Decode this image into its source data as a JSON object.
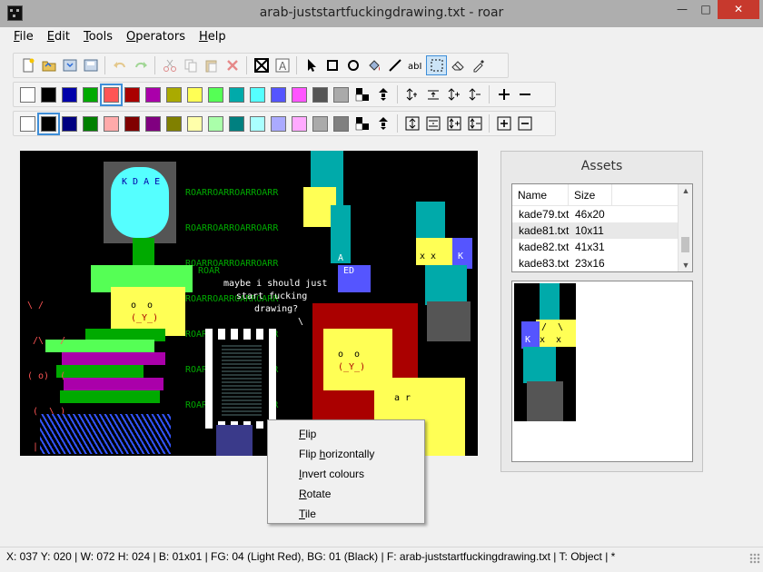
{
  "window": {
    "title": "arab-juststartfuckingdrawing.txt - roar"
  },
  "menu": [
    {
      "label": "File",
      "key": "F",
      "rest": "ile"
    },
    {
      "label": "Edit",
      "key": "E",
      "rest": "dit"
    },
    {
      "label": "Tools",
      "key": "T",
      "rest": "ools"
    },
    {
      "label": "Operators",
      "key": "O",
      "rest": "perators"
    },
    {
      "label": "Help",
      "key": "H",
      "rest": "elp"
    }
  ],
  "palette": {
    "fg": [
      "#ffffff",
      "#000000",
      "#0000aa",
      "#00aa00",
      "#ff5555",
      "#aa0000",
      "#aa00aa",
      "#aaaa00",
      "#ffff55",
      "#55ff55",
      "#00aaaa",
      "#55ffff",
      "#5555ff",
      "#ff55ff",
      "#555555",
      "#aaaaaa"
    ],
    "bg": [
      "#ffffff",
      "#000000",
      "#000080",
      "#008000",
      "#ffaaaa",
      "#800000",
      "#800080",
      "#808000",
      "#ffffaa",
      "#aaffaa",
      "#008080",
      "#aaffff",
      "#aaaaff",
      "#ffaaff",
      "#aaaaaa",
      "#808080"
    ],
    "fg_selected_index": 4,
    "bg_selected_index": 1
  },
  "canvas_text": {
    "roar_lines": [
      "ROARROARROARROARR",
      "ROARROARROARROARR",
      "ROARROARROARROARR",
      "ROARROARROARROARR",
      "ROARROARROARROARR",
      "ROARROARROARROARR",
      "ROARROARROARROARR"
    ],
    "roar_small": "ROAR",
    "speech": [
      "maybe i should just",
      "start fucking",
      "drawing?",
      "\\"
    ],
    "balloon_letters": "K D A E",
    "face1": "o  o",
    "mouth1": "(_Y_)",
    "face2": "o  o",
    "mouth2": "(_Y_)",
    "left_lines": [
      "\\ /",
      " /\\   /",
      "( o)  (",
      " (  \\ )",
      " |(  )/"
    ],
    "ar": "a r",
    "x1": "x x",
    "x2": "x x",
    "k1": "K",
    "ed": "ED",
    "a1": "A"
  },
  "assets": {
    "title": "Assets",
    "columns": [
      "Name",
      "Size"
    ],
    "rows": [
      {
        "name": "kade79.txt",
        "size": "46x20"
      },
      {
        "name": "kade81.txt",
        "size": "10x11"
      },
      {
        "name": "kade82.txt",
        "size": "41x31"
      },
      {
        "name": "kade83.txt",
        "size": "23x16"
      }
    ],
    "selected_row": 1,
    "preview_text": {
      "k": "K",
      "x": "x  x",
      "slash": "/  \\"
    }
  },
  "context_menu": [
    {
      "label": "Flip",
      "key": "F",
      "rest": "lip"
    },
    {
      "label": "Flip horizontally",
      "key": "",
      "pre": "Flip ",
      "key2": "h",
      "rest": "orizontally"
    },
    {
      "label": "Invert colours",
      "key": "I",
      "rest": "nvert colours"
    },
    {
      "label": "Rotate",
      "key": "R",
      "rest": "otate"
    },
    {
      "label": "Tile",
      "key": "T",
      "rest": "ile"
    }
  ],
  "status": {
    "text": "X: 037 Y: 020 | W: 072 H: 024 | B: 01x01 | FG: 04 (Light Red), BG: 01 (Black) | F: arab-juststartfuckingdrawing.txt | T: Object | *"
  }
}
